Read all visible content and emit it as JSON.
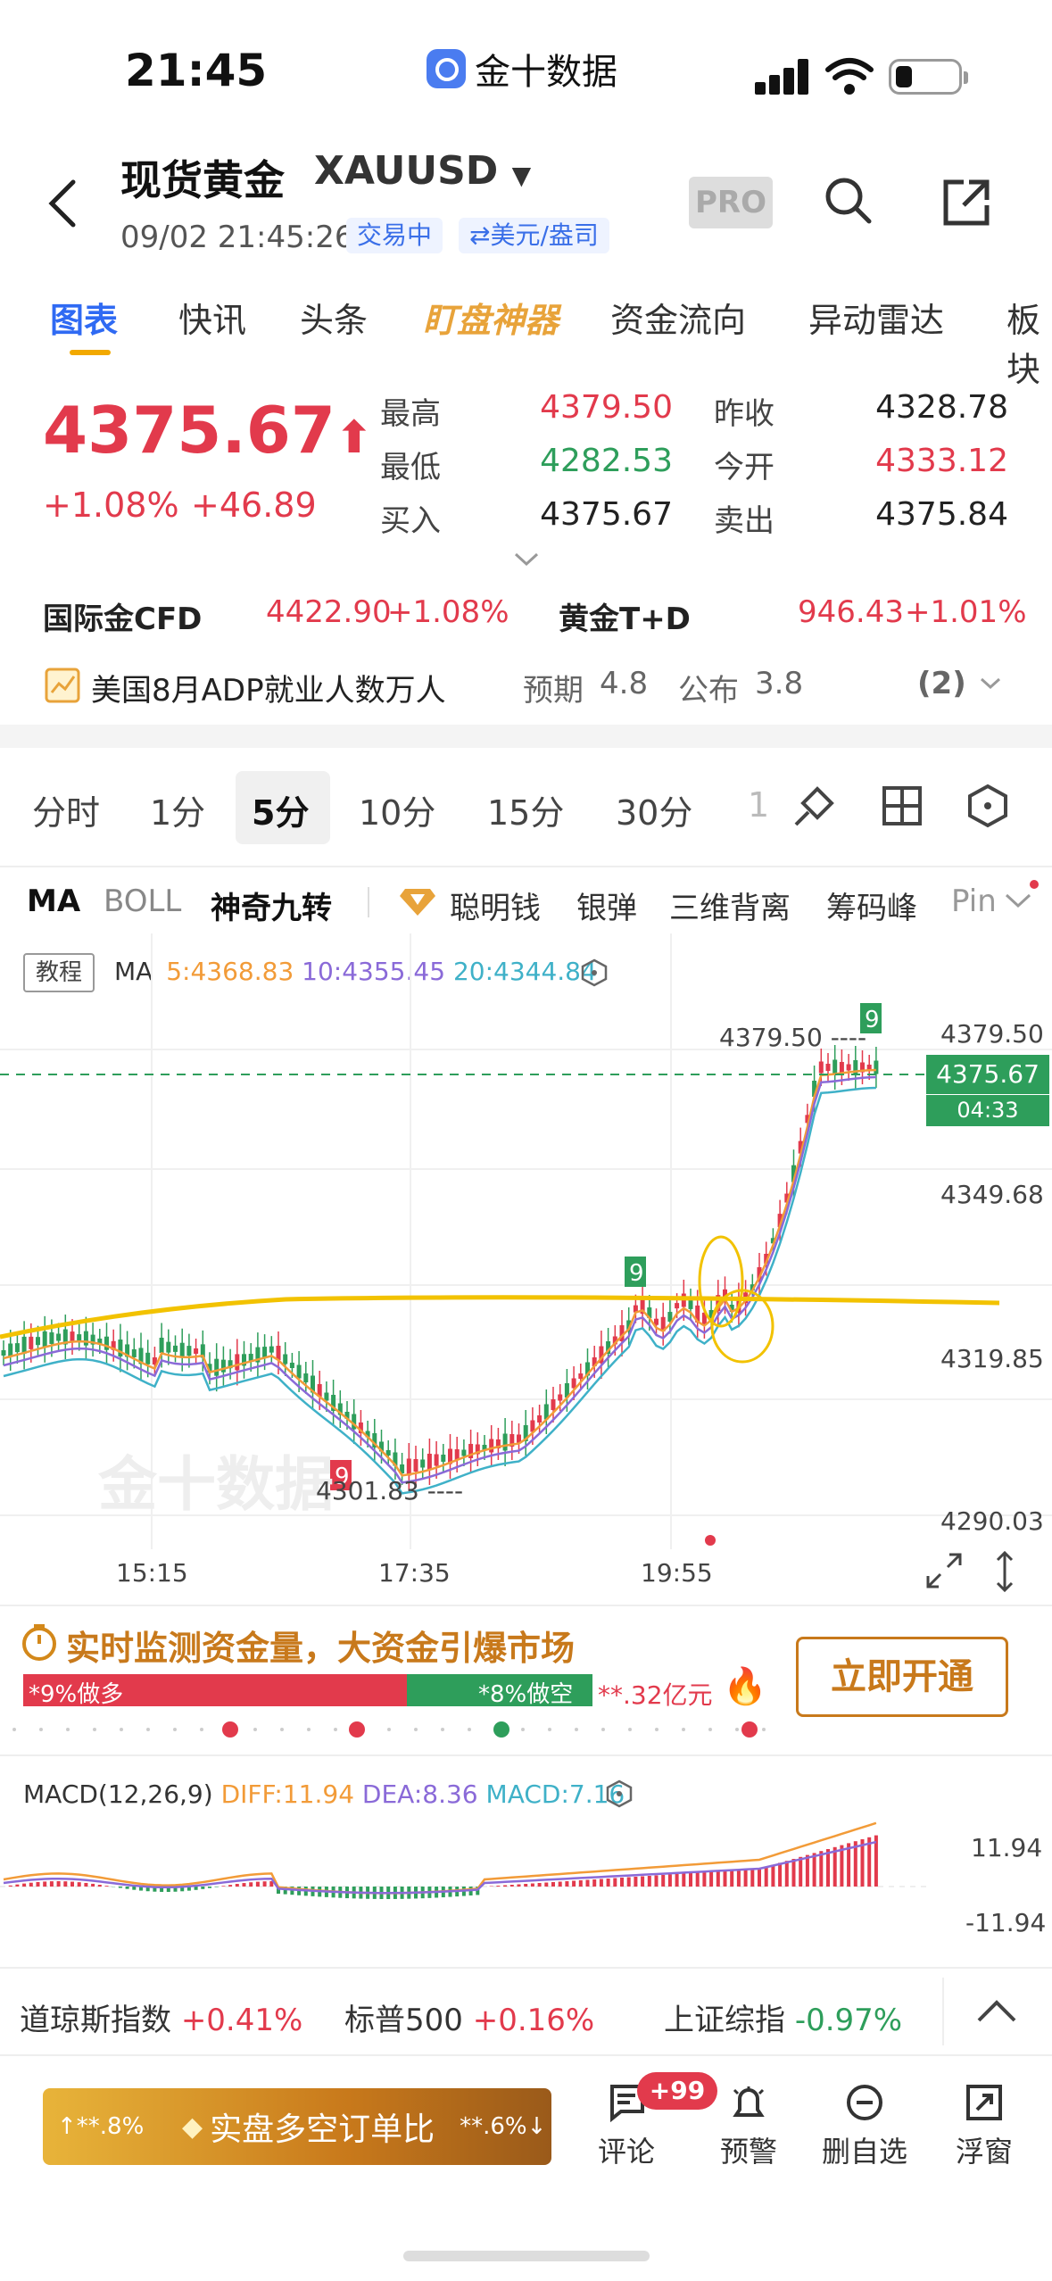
{
  "status": {
    "time": "21:45",
    "app_name": "金十数据"
  },
  "header": {
    "title": "现货黄金",
    "symbol": "XAUUSD",
    "datetime": "09/02 21:45:26",
    "status_tag": "交易中",
    "unit_tag": "⇄美元/盎司",
    "pro": "PRO"
  },
  "tabs": [
    "图表",
    "快讯",
    "头条",
    "盯盘神器",
    "资金流向",
    "异动雷达",
    "板块"
  ],
  "quote": {
    "price": "4375.67",
    "change_pct": "+1.08%",
    "change": "+46.89",
    "high_label": "最高",
    "high": "4379.50",
    "prev_label": "昨收",
    "prev": "4328.78",
    "low_label": "最低",
    "low": "4282.53",
    "open_label": "今开",
    "open": "4333.12",
    "buy_label": "买入",
    "buy": "4375.67",
    "sell_label": "卖出",
    "sell": "4375.84"
  },
  "related": {
    "cfd_label": "国际金CFD",
    "cfd_price": "4422.90",
    "cfd_pct": "+1.08%",
    "td_label": "黄金T+D",
    "td_price": "946.43",
    "td_pct": "+1.01%"
  },
  "news": {
    "text": "美国8月ADP就业人数万人",
    "expect_label": "预期",
    "expect": "4.8",
    "actual_label": "公布",
    "actual": "3.8",
    "count": "(2)"
  },
  "timeframes": [
    "分时",
    "1分",
    "5分",
    "10分",
    "15分",
    "30分",
    "1"
  ],
  "indicators": {
    "ma": "MA",
    "boll": "BOLL",
    "magic": "神奇九转",
    "smart": "聪明钱",
    "silver": "银弹",
    "divergence": "三维背离",
    "chip": "筹码峰",
    "pin": "Pin"
  },
  "chart": {
    "tutorial": "教程",
    "ma_label": "MA",
    "ma5": "5:4368.83",
    "ma10": "10:4355.45",
    "ma20": "20:4344.84",
    "high_mark": "4379.50 ----",
    "low_mark": "4301.83 ----",
    "price_box": "4375.67",
    "countdown": "04:33",
    "y_labels": [
      "4379.50",
      "4349.68",
      "4319.85",
      "4290.03"
    ],
    "x_labels": [
      "15:15",
      "17:35",
      "19:55"
    ],
    "watermark": "金十数据"
  },
  "fund": {
    "title": "实时监测资金量，大资金引爆市场",
    "long": "*9%做多",
    "short": "*8%做空",
    "amount": "**.32亿元",
    "button": "立即开通"
  },
  "macd": {
    "label": "MACD(12,26,9)",
    "diff": "DIFF:11.94",
    "dea": "DEA:8.36",
    "macd": "MACD:7.16",
    "top": "11.94",
    "bottom": "-11.94"
  },
  "tickers": [
    {
      "name": "道琼斯指数",
      "pct": "+0.41%"
    },
    {
      "name": "标普500",
      "pct": "+0.16%"
    },
    {
      "name": "上证综指",
      "pct": "-0.97%"
    }
  ],
  "bottom": {
    "left_pct": "↑**.8%",
    "ratio_label": "实盘多空订单比",
    "right_pct": "**.6%↓",
    "comment": "评论",
    "badge": "+99",
    "alert": "预警",
    "remove": "删自选",
    "float": "浮窗"
  },
  "colors": {
    "red": "#e23a4c",
    "green": "#2e9e5b",
    "blue": "#2f6af3",
    "gold": "#f2c200"
  }
}
